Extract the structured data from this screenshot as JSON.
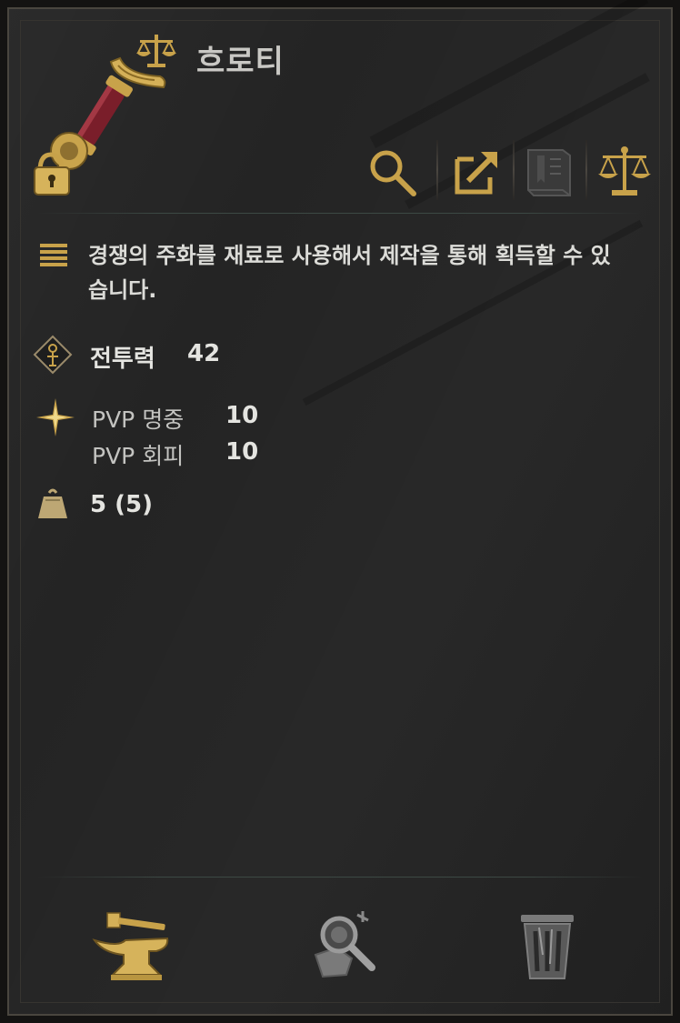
{
  "item": {
    "name": "흐로티",
    "icon": "sword-hilt-with-lock-icon",
    "category_icon": "scale-icon"
  },
  "toolbar": {
    "buttons": [
      {
        "name": "search-button",
        "icon": "magnifier-icon"
      },
      {
        "name": "share-button",
        "icon": "share-icon"
      },
      {
        "name": "codex-button",
        "icon": "book-icon"
      },
      {
        "name": "trade-button",
        "icon": "scale-icon"
      }
    ]
  },
  "description": "경쟁의 주화를 재료로 사용해서 제작을 통해 획득할 수 있습니다.",
  "combat_power": {
    "label": "전투력",
    "value": "42"
  },
  "pvp": [
    {
      "label": "PVP 명중",
      "value": "10"
    },
    {
      "label": "PVP 회피",
      "value": "10"
    }
  ],
  "weight": {
    "icon": "weight-icon",
    "value": "5 (5)"
  },
  "bottom_actions": [
    {
      "name": "craft-button",
      "icon": "anvil-hammer-icon"
    },
    {
      "name": "extract-button",
      "icon": "magnifier-with-scrap-icon"
    },
    {
      "name": "discard-button",
      "icon": "trash-can-icon"
    }
  ],
  "colors": {
    "gold": "#c8a24a",
    "text": "#dcdcd8",
    "panel": "#242424",
    "hilt_red": "#7a1e2a"
  }
}
